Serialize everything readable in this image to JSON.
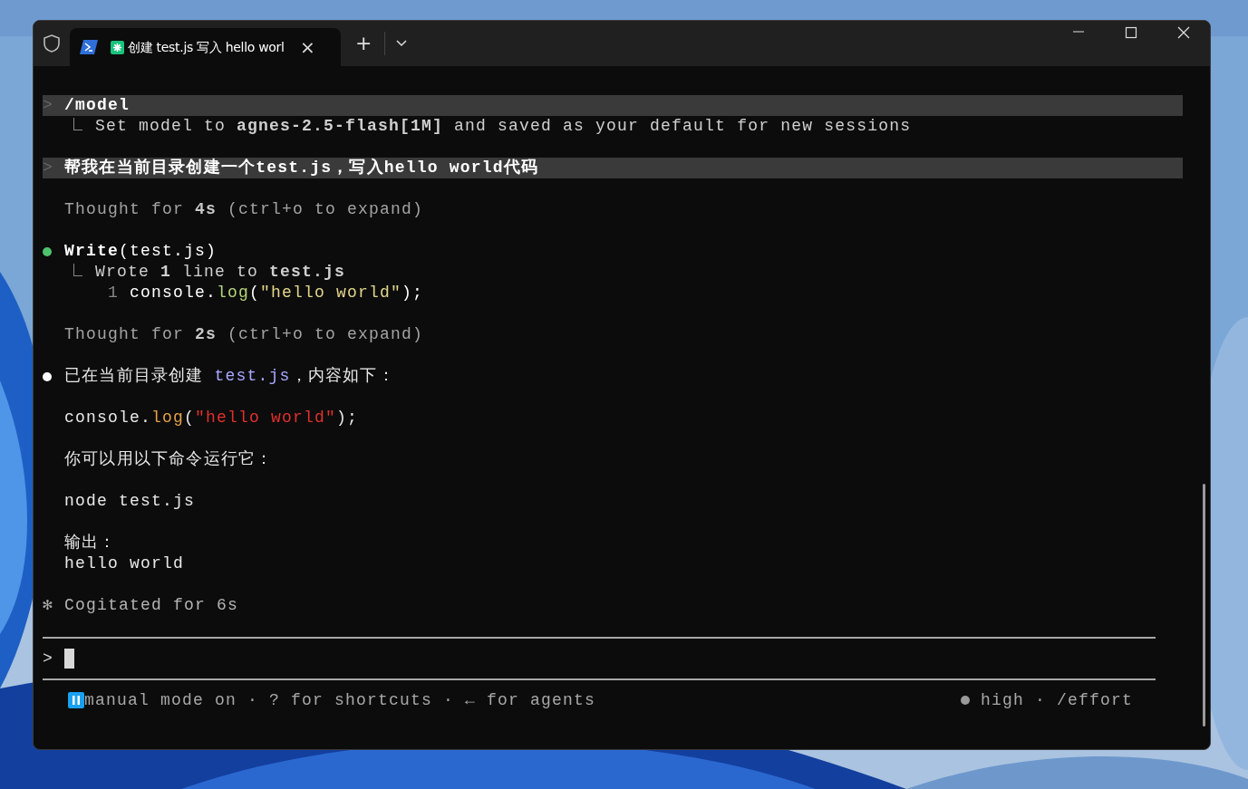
{
  "tab": {
    "title": "创建 test.js 写入 hello worl",
    "close": "×",
    "selected": true
  },
  "new_tab": "+",
  "transcript": [
    {
      "lines": [
        {
          "kind": "prompt",
          "marker": ">",
          "text": "/model"
        },
        {
          "kind": "result",
          "text": "Set model to **agnes-2.5-flash[1M]** and saved as your default for new sessions"
        }
      ]
    },
    {
      "lines": [
        {
          "kind": "prompt",
          "marker": ">",
          "text": "帮我在当前目录创建一个test.js，写入hello world代码"
        }
      ]
    },
    {
      "lines": [
        {
          "kind": "thought",
          "text": "Thought for **4s** (ctrl+o to expand)"
        }
      ]
    },
    {
      "lines": [
        {
          "kind": "tool",
          "color": "#4ec26c",
          "text": "**Write**(test.js)"
        },
        {
          "kind": "result",
          "text": "Wrote **1** line to **test.js**"
        },
        {
          "kind": "code_line",
          "number": "1",
          "tokens": [
            {
              "text": "console.",
              "color": "#ffffff"
            },
            {
              "text": "log",
              "color": "#b5d67c"
            },
            {
              "text": "(",
              "color": "#ffffff"
            },
            {
              "text": "\"hello world\"",
              "color": "#e3d68c"
            },
            {
              "text": ");",
              "color": "#ffffff"
            }
          ]
        }
      ]
    },
    {
      "lines": [
        {
          "kind": "thought",
          "text": "Thought for **2s** (ctrl+o to expand)"
        }
      ]
    },
    {
      "lines": [
        {
          "kind": "message",
          "color": "#ffffff",
          "segments": [
            {
              "kind": "text",
              "text": "已在当前目录创建 "
            },
            {
              "kind": "code",
              "text": "test.js"
            },
            {
              "kind": "text",
              "text": "，内容如下："
            }
          ]
        }
      ]
    },
    {
      "lines": [
        {
          "kind": "code",
          "tokens": [
            {
              "text": "console.",
              "color": "#e8e8e8"
            },
            {
              "text": "log",
              "color": "#e3a24a"
            },
            {
              "text": "(",
              "color": "#e8e8e8"
            },
            {
              "text": "\"hello world\"",
              "color": "#e0302e"
            },
            {
              "text": ");",
              "color": "#e8e8e8"
            }
          ]
        }
      ]
    },
    {
      "lines": [
        {
          "kind": "text",
          "text": "你可以用以下命令运行它："
        }
      ]
    },
    {
      "lines": [
        {
          "kind": "text",
          "text": "node test.js"
        }
      ]
    },
    {
      "lines": [
        {
          "kind": "text",
          "text": "输出："
        },
        {
          "kind": "text",
          "text": "hello world"
        }
      ]
    },
    {
      "lines": [
        {
          "kind": "status",
          "symbol": "✻",
          "text": "Cogitated for 6s"
        }
      ]
    }
  ],
  "input": {
    "prompt": ">"
  },
  "footer": {
    "hints": "manual mode on · ? for shortcuts · ← for agents",
    "effort": "high · /effort"
  }
}
